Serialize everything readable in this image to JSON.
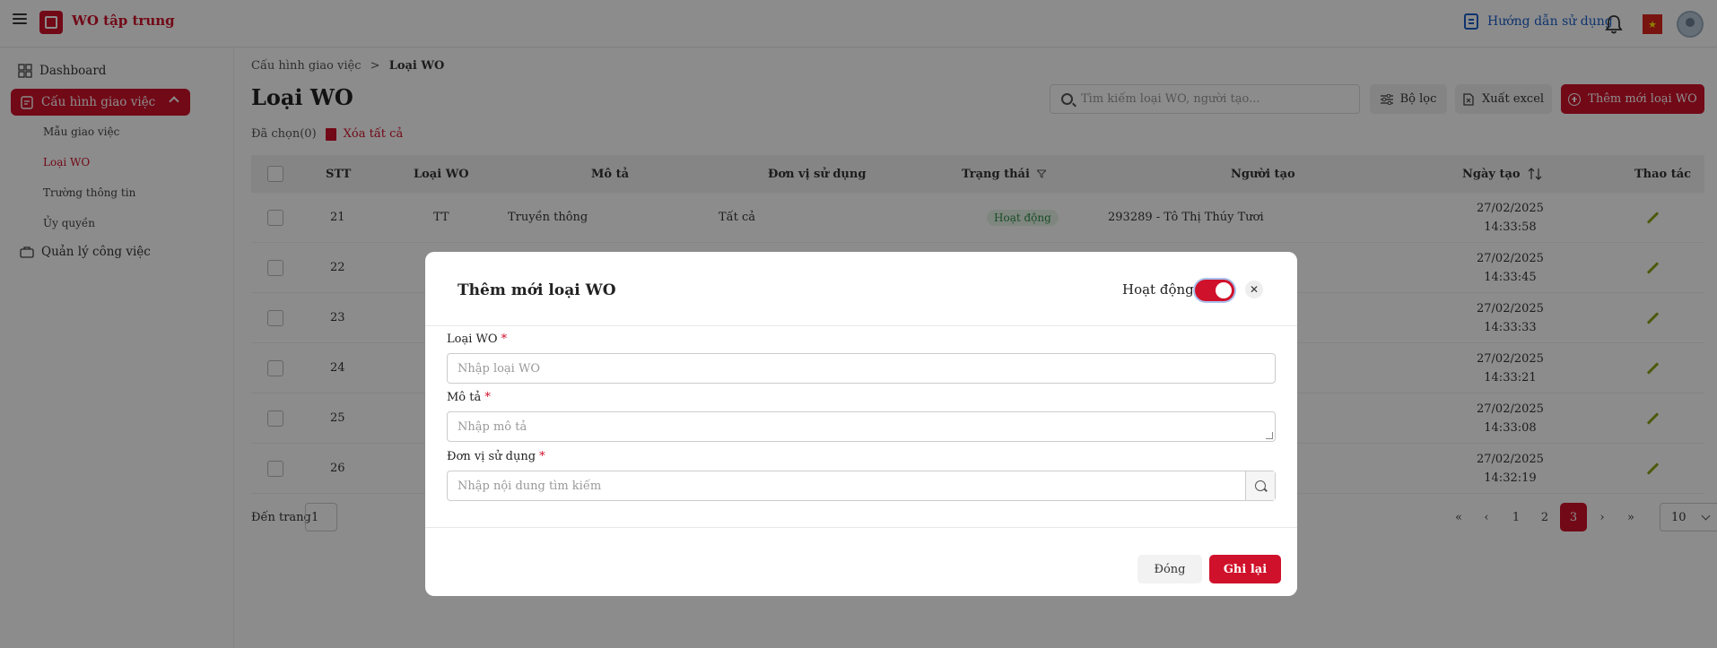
{
  "app": {
    "title": "WO tập trung"
  },
  "header": {
    "guide_label": "Hướng dẫn sử dụng"
  },
  "sidebar": {
    "items": [
      {
        "label": "Dashboard"
      },
      {
        "label": "Cấu hình giao việc"
      },
      {
        "label": "Mẫu giao việc"
      },
      {
        "label": "Loại WO"
      },
      {
        "label": "Trường thông tin"
      },
      {
        "label": "Ủy quyền"
      },
      {
        "label": "Quản lý công việc"
      }
    ]
  },
  "breadcrumb": {
    "parent": "Cấu hình giao việc",
    "separator": ">",
    "current": "Loại WO"
  },
  "page": {
    "title": "Loại WO"
  },
  "toolbar": {
    "search_placeholder": "Tìm kiếm loại WO, người tạo...",
    "filter_label": "Bộ lọc",
    "export_label": "Xuất excel",
    "add_label": "Thêm mới loại WO"
  },
  "selection": {
    "selected_text": "Đã chọn(0)",
    "delete_all_label": "Xóa tất cả"
  },
  "table": {
    "columns": [
      "STT",
      "Loại WO",
      "Mô tả",
      "Đơn vị sử dụng",
      "Trạng thái",
      "Người tạo",
      "Ngày tạo",
      "Thao tác"
    ],
    "rows": [
      {
        "stt": "21",
        "loai": "TT",
        "mota": "Truyền thông",
        "donvi": "Tất cả",
        "status": "Hoạt động",
        "creator": "293289 - Tô Thị Thúy Tươi",
        "date": "27/02/2025",
        "time": "14:33:58"
      },
      {
        "stt": "22",
        "loai": "",
        "mota": "",
        "donvi": "",
        "status": "",
        "creator": "",
        "date": "27/02/2025",
        "time": "14:33:45"
      },
      {
        "stt": "23",
        "loai": "",
        "mota": "",
        "donvi": "",
        "status": "",
        "creator": "",
        "date": "27/02/2025",
        "time": "14:33:33"
      },
      {
        "stt": "24",
        "loai": "",
        "mota": "",
        "donvi": "",
        "status": "",
        "creator": "",
        "date": "27/02/2025",
        "time": "14:33:21"
      },
      {
        "stt": "25",
        "loai": "",
        "mota": "",
        "donvi": "",
        "status": "",
        "creator": "",
        "date": "27/02/2025",
        "time": "14:33:08"
      },
      {
        "stt": "26",
        "loai": "",
        "mota": "",
        "donvi": "",
        "status": "",
        "creator": "",
        "date": "27/02/2025",
        "time": "14:32:19"
      }
    ]
  },
  "pager": {
    "goto_label": "Đến trang",
    "goto_value": "1",
    "pages": [
      "1",
      "2",
      "3"
    ],
    "active_page": "3",
    "page_size": "10"
  },
  "modal": {
    "title": "Thêm mới loại WO",
    "active_label": "Hoạt động",
    "fields": {
      "loai_label": "Loại WO",
      "loai_placeholder": "Nhập loại WO",
      "mota_label": "Mô tả",
      "mota_placeholder": "Nhập mô tả",
      "donvi_label": "Đơn vị sử dụng",
      "donvi_placeholder": "Nhập nội dung tìm kiếm"
    },
    "required_mark": "*",
    "close_label": "Đóng",
    "save_label": "Ghi lại"
  },
  "colors": {
    "brand": "#d0112b",
    "status_active": "#2e8b46",
    "link": "#1b5fc9"
  }
}
